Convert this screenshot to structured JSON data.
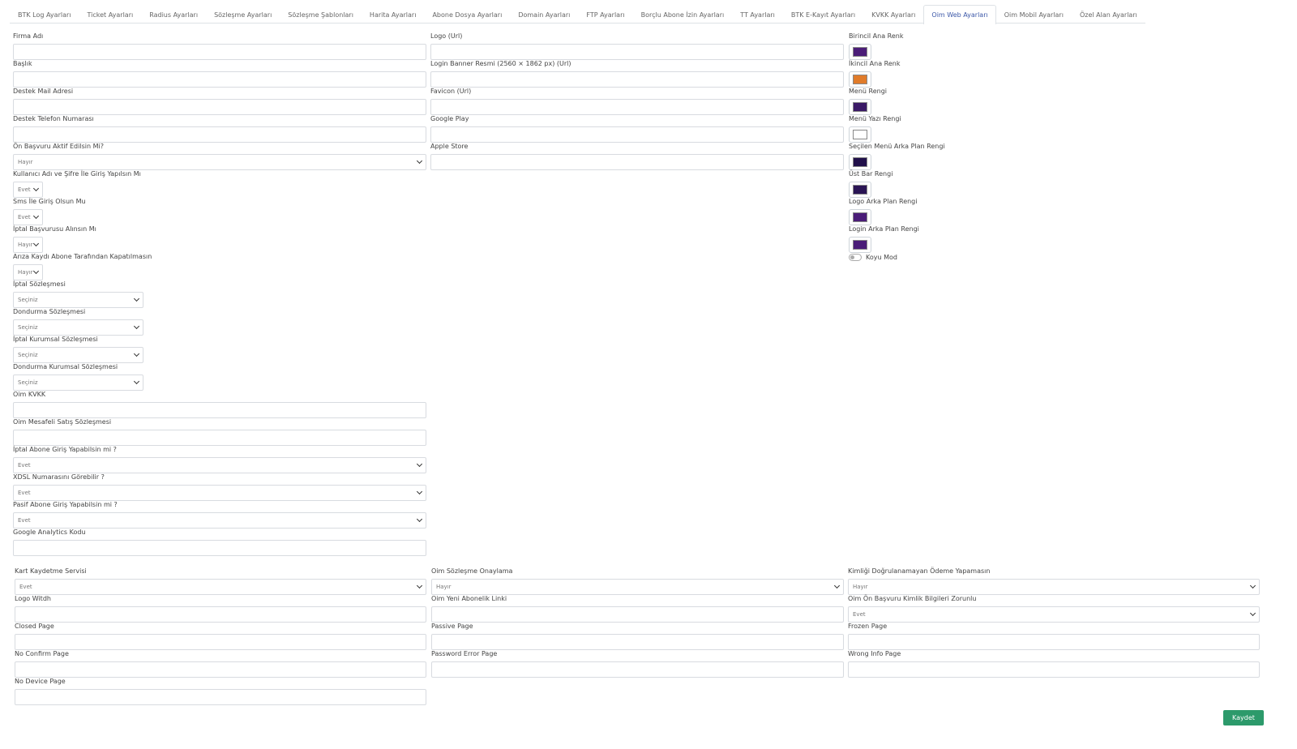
{
  "tabs": [
    {
      "label": "BTK Log Ayarları"
    },
    {
      "label": "Ticket Ayarları"
    },
    {
      "label": "Radius Ayarları"
    },
    {
      "label": "Sözleşme Ayarları"
    },
    {
      "label": "Sözleşme Şablonları"
    },
    {
      "label": "Harita Ayarları"
    },
    {
      "label": "Abone Dosya Ayarları"
    },
    {
      "label": "Domain Ayarları"
    },
    {
      "label": "FTP Ayarları"
    },
    {
      "label": "Borçlu Abone İzin Ayarları"
    },
    {
      "label": "TT Ayarları"
    },
    {
      "label": "BTK E-Kayıt Ayarları"
    },
    {
      "label": "KVKK Ayarları"
    },
    {
      "label": "Oim Web Ayarları",
      "active": true
    },
    {
      "label": "Oim Mobil Ayarları"
    },
    {
      "label": "Özel Alan Ayarları"
    }
  ],
  "left": {
    "firma_adi": {
      "label": "Firma Adı",
      "value": ""
    },
    "baslik": {
      "label": "Başlık",
      "value": ""
    },
    "destek_mail": {
      "label": "Destek Mail Adresi",
      "value": ""
    },
    "destek_telefon": {
      "label": "Destek Telefon Numarası",
      "value": ""
    },
    "on_basvuru": {
      "label": "Ön Başvuru Aktif Edilsin Mi?",
      "value": "Hayır"
    },
    "kullanici_giris": {
      "label": "Kullanıcı Adı ve Şifre İle Giriş Yapılsın Mı",
      "value": "Evet"
    },
    "sms_giris": {
      "label": "Sms İle Giriş Olsun Mu",
      "value": "Evet"
    },
    "iptal_basvuru": {
      "label": "İptal Başvurusu Alınsın Mı",
      "value": "Hayır"
    },
    "ariza_kaydi": {
      "label": "Arıza Kaydı Abone Tarafından Kapatılmasın",
      "value": "Hayır"
    },
    "iptal_sozlesme": {
      "label": "İptal Sözleşmesi",
      "value": "Seçiniz"
    },
    "dondurma_sozlesme": {
      "label": "Dondurma Sözleşmesi",
      "value": "Seçiniz"
    },
    "iptal_kurumsal": {
      "label": "İptal Kurumsal Sözleşmesi",
      "value": "Seçiniz"
    },
    "dondurma_kurumsal": {
      "label": "Dondurma Kurumsal Sözleşmesi",
      "value": "Seçiniz"
    },
    "oim_kvkk": {
      "label": "Oim KVKK",
      "value": ""
    },
    "oim_mesafeli": {
      "label": "Oim Mesafeli Satış Sözleşmesi",
      "value": ""
    },
    "iptal_abone_giris": {
      "label": "İptal Abone Giriş Yapabilsin mi ?",
      "value": "Evet"
    },
    "xdsl_numara": {
      "label": "XDSL Numarasını Görebilir ?",
      "value": "Evet"
    },
    "pasif_abone_giris": {
      "label": "Pasif Abone Giriş Yapabilsin mi ?",
      "value": "Evet"
    },
    "google_analytics": {
      "label": "Google Analytics Kodu",
      "value": ""
    }
  },
  "middle": {
    "logo_url": {
      "label": "Logo (Url)",
      "value": ""
    },
    "login_banner": {
      "label": "Login Banner Resmi (2560 × 1862 px) (Url)",
      "value": ""
    },
    "favicon": {
      "label": "Favicon (Url)",
      "value": ""
    },
    "google_play": {
      "label": "Google Play",
      "value": ""
    },
    "apple_store": {
      "label": "Apple Store",
      "value": ""
    }
  },
  "colors": {
    "birincil": {
      "label": "Birincil Ana Renk",
      "color": "#4b1d78"
    },
    "ikincil": {
      "label": "İkincil Ana Renk",
      "color": "#e07b2a"
    },
    "menu": {
      "label": "Menü Rengi",
      "color": "#3b1a66"
    },
    "menu_yazi": {
      "label": "Menü Yazı Rengi",
      "color": "#ffffff"
    },
    "secilen_menu": {
      "label": "Seçilen Menü Arka Plan Rengi",
      "color": "#21104a"
    },
    "ust_bar": {
      "label": "Üst Bar Rengi",
      "color": "#2a1454"
    },
    "logo_arka": {
      "label": "Logo Arka Plan Rengi",
      "color": "#4b1d78"
    },
    "login_arka": {
      "label": "Login Arka Plan Rengi",
      "color": "#4b1d78"
    },
    "koyu_mod": {
      "label": "Koyu Mod",
      "enabled": false
    }
  },
  "bottom": {
    "kart_kaydetme": {
      "label": "Kart Kaydetme Servisi",
      "value": "Evet"
    },
    "logo_width": {
      "label": "Logo Witdh",
      "value": ""
    },
    "closed_page": {
      "label": "Closed Page",
      "value": ""
    },
    "no_confirm_page": {
      "label": "No Confirm Page",
      "value": ""
    },
    "no_device_page": {
      "label": "No Device Page",
      "value": ""
    },
    "oim_sozlesme_onay": {
      "label": "Oim Sözleşme Onaylama",
      "value": "Hayır"
    },
    "oim_yeni_abonelik": {
      "label": "Oim Yeni Abonelik Linki",
      "value": ""
    },
    "passive_page": {
      "label": "Passive Page",
      "value": ""
    },
    "password_error_page": {
      "label": "Password Error Page",
      "value": ""
    },
    "kimligi_dogrulanamayan": {
      "label": "Kimliği Doğrulanamayan Ödeme Yapamasın",
      "value": "Hayır"
    },
    "oim_on_basvuru_kimlik": {
      "label": "Oim Ön Başvuru Kimlik Bilgileri Zorunlu",
      "value": "Evet"
    },
    "frozen_page": {
      "label": "Frozen Page",
      "value": ""
    },
    "wrong_info_page": {
      "label": "Wrong Info Page",
      "value": ""
    }
  },
  "actions": {
    "save_label": "Kaydet",
    "save_color": "#2c9a6b"
  }
}
